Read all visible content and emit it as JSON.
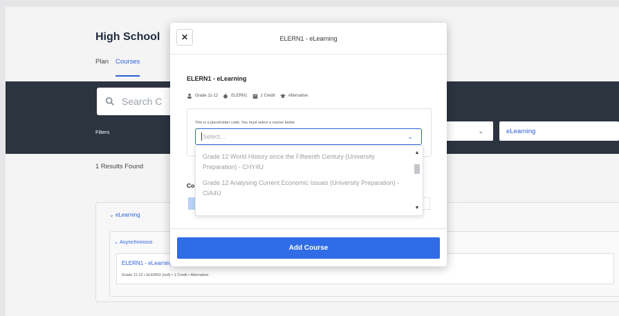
{
  "page": {
    "title": "High School",
    "tabs": [
      "Plan",
      "Courses"
    ],
    "search_placeholder": "Search C",
    "filters_label": "Filters",
    "filter_values": [
      "",
      "eLearning"
    ],
    "results_text": "1 Results Found",
    "group_label": "eLearning",
    "subgroup_label": "Asynchronous",
    "course_title": "ELERN1 - eLearning",
    "course_meta": "Grade 11-12 • ELERN1 (null) • 1 Credit • Alternative"
  },
  "modal": {
    "close_glyph": "✕",
    "title": "ELERN1 - eLearning",
    "heading": "ELERN1 - eLearning",
    "meta": {
      "grade": "Grade 11-12",
      "code": "ELERN1",
      "credit": "1 Credit",
      "type": "Alternative"
    },
    "placeholder_note": "This is a placeholder code. You must select a course below",
    "select_placeholder": "Select...",
    "options": [
      "Grade 12 World History since the Fifteenth Century (University Preparation) - CHY4U",
      "Grade 12 Analysing Current Economic Issues (University Preparation) - CIA4U"
    ],
    "partial_label": "Co",
    "add_button": "Add Course"
  },
  "colors": {
    "accent": "#2f6ce5",
    "link": "#2b5fd9",
    "dark_band": "#2c3440"
  }
}
